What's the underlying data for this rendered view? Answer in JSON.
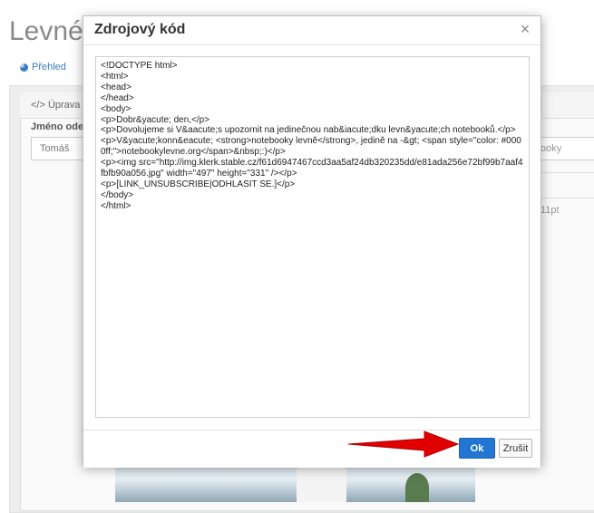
{
  "background": {
    "page_title": "Levné",
    "nav_overview": "Přehled",
    "card_header": "</> Úprava",
    "sender_label": "Jméno ode",
    "sender_value": "Tomáš",
    "right_value": "ooky",
    "font_size": "11pt"
  },
  "dialog": {
    "title": "Zdrojový kód",
    "close_label": "×",
    "source_code": "<!DOCTYPE html>\n<html>\n<head>\n</head>\n<body>\n<p>Dobr&yacute; den,</p>\n<p>Dovolujeme si V&aacute;s upozornit na jedinečnou nab&iacute;dku levn&yacute;ch notebooků.</p>\n<p>V&yacute;konn&eacute; <strong>notebooky levně</strong>, jedině na -&gt; <span style=\"color: #0000ff;\">notebookylevne.org</span>&nbsp;:)</p>\n<p><img src=\"http://img.klerk.stable.cz/f61d6947467ccd3aa5af24db320235dd/e81ada256e72bf99b7aaf4fbfb90a056.jpg\" width=\"497\" height=\"331\" /></p>\n<p>[LINK_UNSUBSCRIBE|ODHLASIT SE.]</p>\n</body>\n</html>",
    "ok_label": "Ok",
    "cancel_label": "Zrušit"
  },
  "colors": {
    "primary_button": "#2276d2",
    "annotation_arrow": "#e00000"
  }
}
